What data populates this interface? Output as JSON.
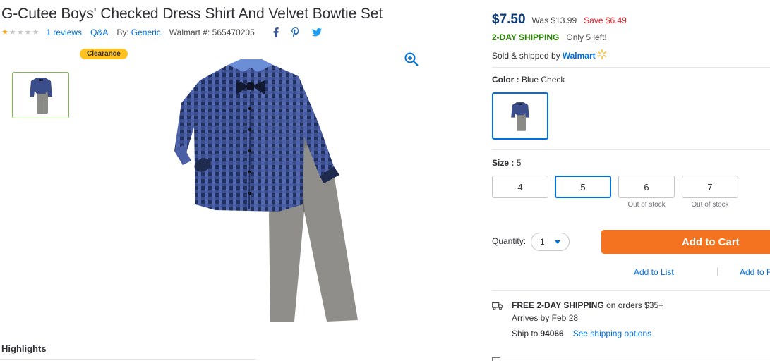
{
  "product": {
    "title": "G-Cutee Boys' Checked Dress Shirt And Velvet Bowtie Set",
    "rating": 1,
    "reviews_text": "1 reviews",
    "qa_text": "Q&A",
    "brand_label": "By:",
    "brand": "Generic",
    "walmart_number_text": "Walmart #: 565470205"
  },
  "badge": {
    "label": "Clearance",
    "color": "#ffc220"
  },
  "icons": {
    "zoom": "zoom-in-icon",
    "facebook": "facebook-icon",
    "pinterest": "pinterest-icon",
    "twitter": "twitter-icon",
    "truck": "truck-icon"
  },
  "pricing": {
    "price": "$7.50",
    "was": "Was $13.99",
    "save": "Save $6.49",
    "price_color": "#0b3a75",
    "save_color": "#de1c24"
  },
  "shipping": {
    "two_day": "2-DAY SHIPPING",
    "stock": "Only 5 left!",
    "sold_by": "Sold & shipped by",
    "seller": "Walmart"
  },
  "variants": {
    "color_label": "Color :",
    "color_value": "Blue Check",
    "size_label": "Size :",
    "size_value": "5",
    "sizes": [
      {
        "label": "4",
        "note": ""
      },
      {
        "label": "5",
        "note": ""
      },
      {
        "label": "6",
        "note": "Out of stock"
      },
      {
        "label": "7",
        "note": "Out of stock"
      }
    ]
  },
  "purchase": {
    "quantity_label": "Quantity:",
    "quantity_value": "1",
    "add_to_cart": "Add to Cart",
    "add_to_list": "Add to List",
    "add_to_registry": "Add to Registry",
    "cart_color": "#f47321"
  },
  "delivery": {
    "free_bold": "FREE 2-DAY SHIPPING",
    "free_rest": "on orders $35+",
    "arrives": "Arrives by Feb 28",
    "ship_to_label": "Ship to",
    "zip": "94066",
    "options_link": "See shipping options"
  },
  "sections": {
    "highlights": "Highlights"
  }
}
